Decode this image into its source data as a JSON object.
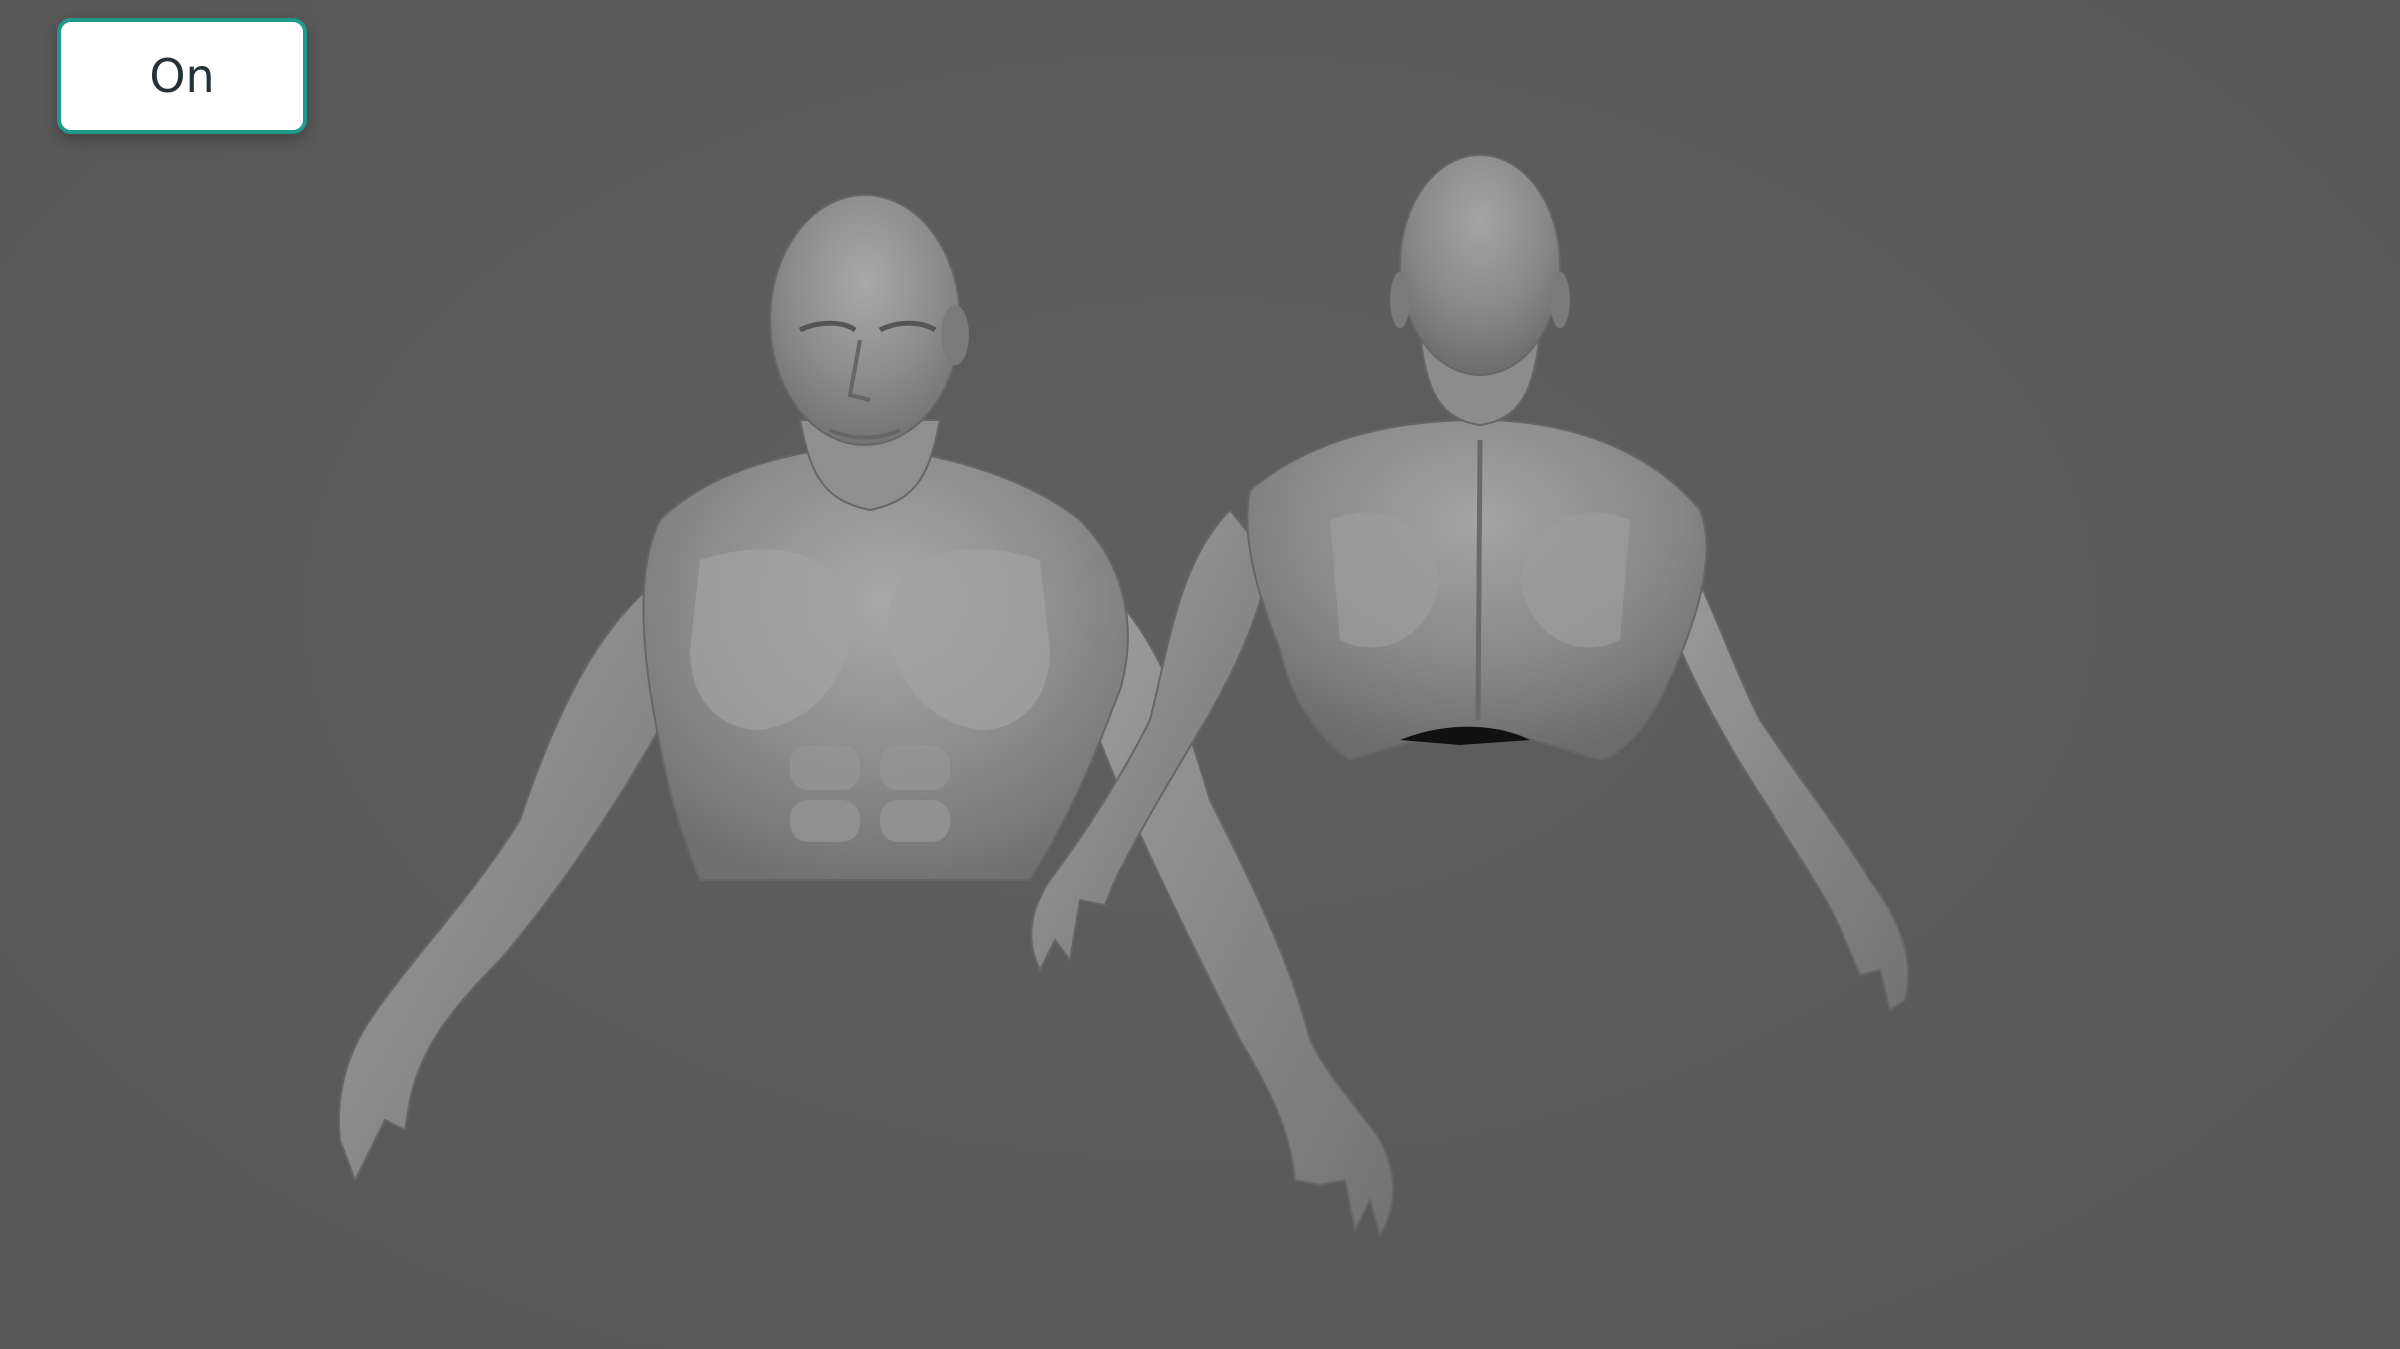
{
  "toggle": {
    "label": "On"
  },
  "colors": {
    "background": "#5b5b5b",
    "button_border": "#1f9a8a",
    "button_text": "#263238",
    "model_base": "#8a8a8a",
    "model_highlight": "#b5b5b5",
    "model_shadow": "#5e5e5e"
  },
  "icons": {
    "front_view": "torso-front-model",
    "back_view": "torso-back-model"
  }
}
